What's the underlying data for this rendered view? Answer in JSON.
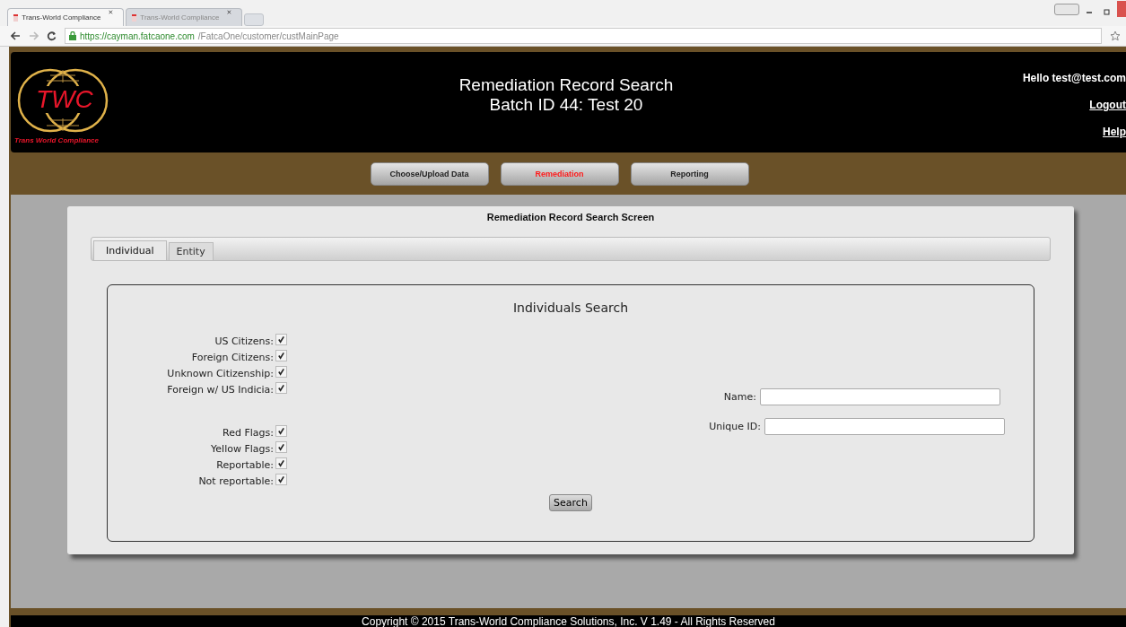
{
  "browser": {
    "tabs": [
      {
        "title": "Trans-World Compliance",
        "selected": true
      },
      {
        "title": "Trans-World Compliance",
        "selected": false
      }
    ],
    "url_host": "https://cayman.fatcaone.com",
    "url_path": "/FatcaOne/customer/custMainPage"
  },
  "header": {
    "logo_text": "TWC",
    "logo_caption": "Trans World Compliance",
    "title": "Remediation Record Search",
    "subtitle": "Batch ID 44: Test 20",
    "greeting": "Hello test@test.com",
    "links": [
      "Logout",
      "Help"
    ]
  },
  "nav": [
    {
      "label": "Choose/Upload Data",
      "selected": false
    },
    {
      "label": "Remediation",
      "selected": true
    },
    {
      "label": "Reporting",
      "selected": false
    }
  ],
  "panel_title": "Remediation Record Search Screen",
  "tabs": [
    {
      "label": "Individual",
      "selected": true
    },
    {
      "label": "Entity",
      "selected": false
    }
  ],
  "search": {
    "title": "Individuals Search",
    "groups": [
      [
        {
          "label": "US Citizens:",
          "checked": true
        },
        {
          "label": "Foreign Citizens:",
          "checked": true
        },
        {
          "label": "Unknown Citizenship:",
          "checked": true
        },
        {
          "label": "Foreign w/ US Indicia:",
          "checked": true
        }
      ],
      [
        {
          "label": "Red Flags:",
          "checked": true
        },
        {
          "label": "Yellow Flags:",
          "checked": true
        },
        {
          "label": "Reportable:",
          "checked": true
        },
        {
          "label": "Not reportable:",
          "checked": true
        }
      ]
    ],
    "fields": [
      {
        "label": "Name:"
      },
      {
        "label": "Unique ID:"
      }
    ],
    "button": "Search"
  },
  "footer": "Copyright © 2015 Trans-World Compliance Solutions, Inc. V 1.49 - All Rights Reserved"
}
